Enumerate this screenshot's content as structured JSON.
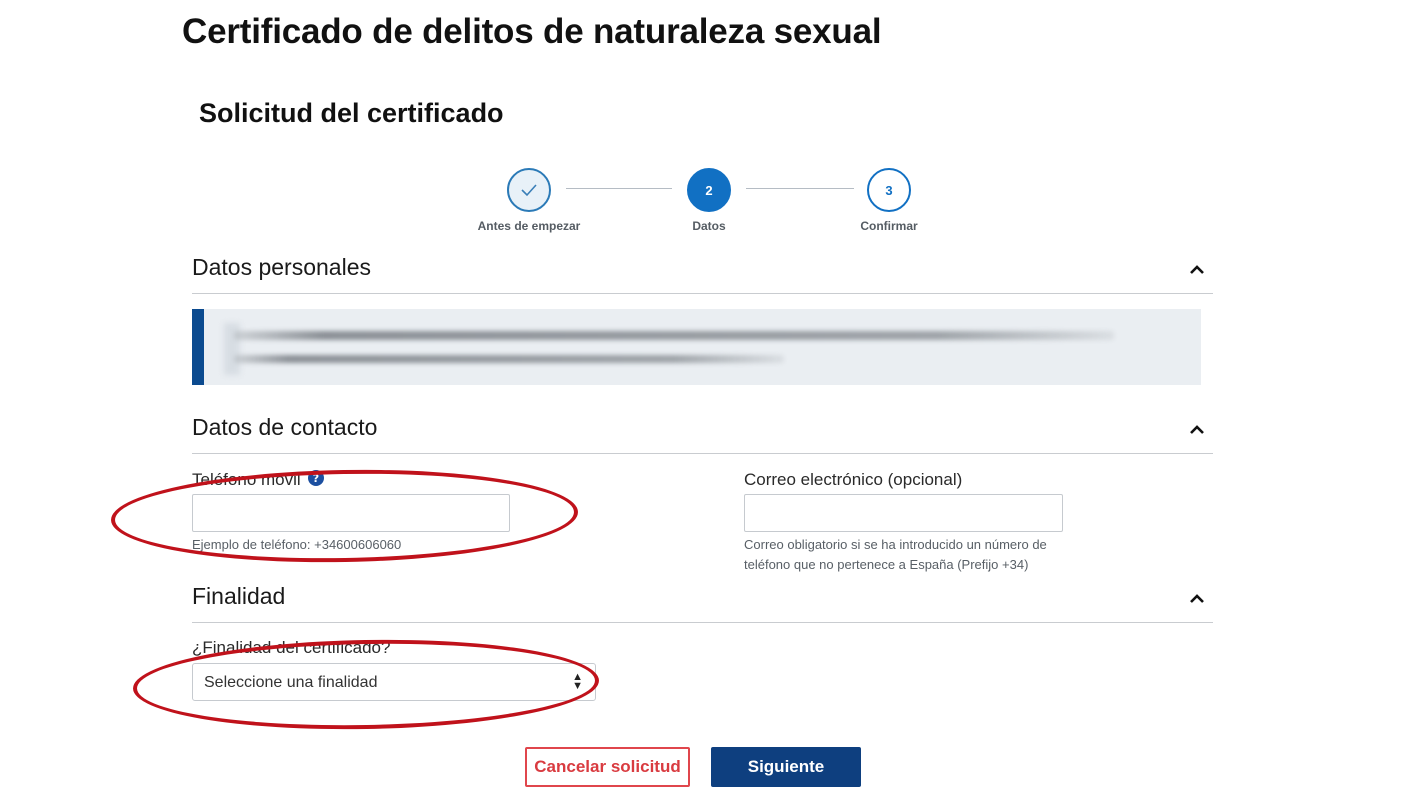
{
  "page": {
    "title": "Certificado de delitos de naturaleza sexual",
    "subtitle": "Solicitud del certificado"
  },
  "stepper": {
    "steps": [
      {
        "number": "",
        "label": "Antes de empezar",
        "state": "done"
      },
      {
        "number": "2",
        "label": "Datos",
        "state": "active"
      },
      {
        "number": "3",
        "label": "Confirmar",
        "state": "pending"
      }
    ]
  },
  "sections": {
    "personal": {
      "title": "Datos personales"
    },
    "contact": {
      "title": "Datos de contacto"
    },
    "purpose": {
      "title": "Finalidad"
    }
  },
  "contact": {
    "phone_label": "Teléfono móvil",
    "phone_value": "",
    "phone_hint": "Ejemplo de teléfono: +34600606060",
    "email_label": "Correo electrónico  (opcional)",
    "email_value": "",
    "email_hint_line1": "Correo obligatorio si se ha introducido un número de",
    "email_hint_line2": "teléfono que no pertenece a España (Prefijo +34)"
  },
  "purpose": {
    "label": "¿Finalidad del certificado?",
    "selected": "Seleccione una finalidad"
  },
  "buttons": {
    "cancel": "Cancelar solicitud",
    "next": "Siguiente"
  },
  "icons": {
    "info": "info-icon",
    "check": "check-icon",
    "collapse": "chevron-up-icon"
  },
  "colors": {
    "primary": "#1170c3",
    "dark_blue": "#0e3f7f",
    "cancel_red": "#d93b40",
    "annotation_red": "#c0121b"
  }
}
